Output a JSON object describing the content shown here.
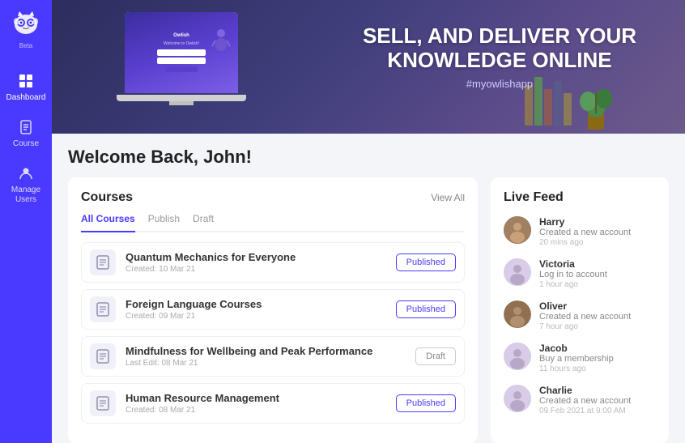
{
  "sidebar": {
    "logo_label": "Owlish",
    "beta_label": "Beta",
    "items": [
      {
        "id": "dashboard",
        "label": "Dashboard",
        "icon": "grid"
      },
      {
        "id": "course",
        "label": "Course",
        "icon": "document"
      },
      {
        "id": "manage-users",
        "label": "Manage Users",
        "icon": "person"
      }
    ]
  },
  "hero": {
    "headline_line1": "SELL, AND DELIVER YOUR",
    "headline_line2": "KNOWLEDGE ONLINE",
    "hashtag": "#myowlishapp",
    "laptop_screen_title": "Owlish",
    "laptop_screen_subtitle": "Welcome to Owlish!"
  },
  "content": {
    "welcome_message": "Welcome Back, John!",
    "courses_section": {
      "title": "Courses",
      "tabs": [
        {
          "id": "all",
          "label": "All Courses",
          "active": true
        },
        {
          "id": "publish",
          "label": "Publish",
          "active": false
        },
        {
          "id": "draft",
          "label": "Draft",
          "active": false
        }
      ],
      "view_all_label": "View All",
      "items": [
        {
          "id": 1,
          "name": "Quantum Mechanics for Everyone",
          "meta": "Created: 10 Mar 21",
          "status": "Published",
          "status_type": "published"
        },
        {
          "id": 2,
          "name": "Foreign Language Courses",
          "meta": "Created: 09 Mar 21",
          "status": "Published",
          "status_type": "published"
        },
        {
          "id": 3,
          "name": "Mindfulness for Wellbeing and Peak Performance",
          "meta": "Last Edit: 08 Mar 21",
          "status": "Draft",
          "status_type": "draft"
        },
        {
          "id": 4,
          "name": "Human Resource Management",
          "meta": "Created: 08 Mar 21",
          "status": "Published",
          "status_type": "published"
        }
      ]
    },
    "live_feed": {
      "title": "Live Feed",
      "items": [
        {
          "name": "Harry",
          "action": "Created a new account",
          "time": "20 mins ago",
          "avatar_type": "photo",
          "avatar_color": "harry"
        },
        {
          "name": "Victoria",
          "action": "Log in to account",
          "time": "1 hour ago",
          "avatar_type": "placeholder",
          "avatar_color": "victoria"
        },
        {
          "name": "Oliver",
          "action": "Created a new account",
          "time": "7 hour ago",
          "avatar_type": "photo",
          "avatar_color": "oliver"
        },
        {
          "name": "Jacob",
          "action": "Buy a membership",
          "time": "11 hours ago",
          "avatar_type": "placeholder",
          "avatar_color": "jacob"
        },
        {
          "name": "Charlie",
          "action": "Created a new account",
          "time": "09 Feb 2021 at 9:00 AM",
          "avatar_type": "placeholder",
          "avatar_color": "charlie"
        }
      ]
    }
  }
}
